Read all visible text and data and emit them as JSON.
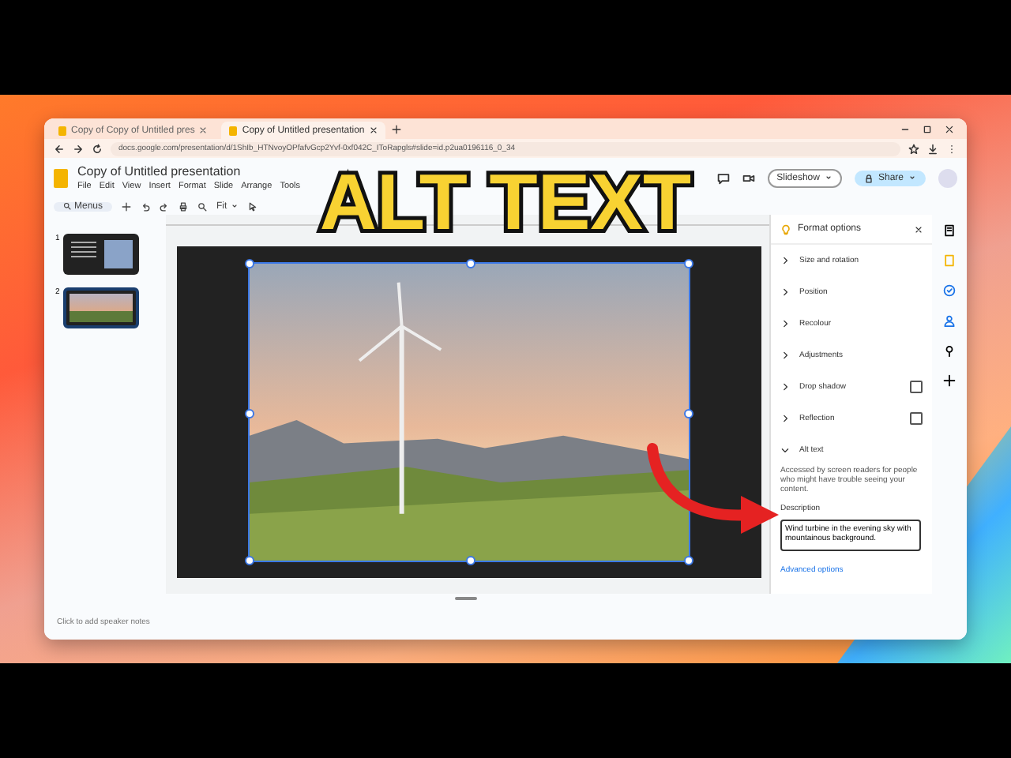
{
  "browser": {
    "tabs": [
      {
        "label": "Copy of Copy of Untitled pres",
        "selected": false
      },
      {
        "label": "Copy of Untitled presentation",
        "selected": true
      }
    ],
    "url": "docs.google.com/presentation/d/1ShIb_HTNvoyOPfafvGcp2Yvf-0xf042C_IToRapgls#slide=id.p2ua0196116_0_34"
  },
  "document": {
    "title": "Copy of Untitled presentation",
    "menus": [
      "File",
      "Edit",
      "View",
      "Insert",
      "Format",
      "Slide",
      "Arrange",
      "Tools"
    ]
  },
  "toolbar": {
    "search": "Menus",
    "zoom": "Fit"
  },
  "header_buttons": {
    "slideshow": "Slideshow",
    "share": "Share"
  },
  "slides": [
    {
      "number": "1",
      "selected": false
    },
    {
      "number": "2",
      "selected": true
    }
  ],
  "speaker_notes": {
    "placeholder": "Click to add speaker notes"
  },
  "format_panel": {
    "title": "Format options",
    "sections": [
      {
        "label": "Size and rotation",
        "kind": "plain",
        "expanded": false
      },
      {
        "label": "Position",
        "kind": "plain",
        "expanded": false
      },
      {
        "label": "Recolour",
        "kind": "plain",
        "expanded": false
      },
      {
        "label": "Adjustments",
        "kind": "plain",
        "expanded": false
      },
      {
        "label": "Drop shadow",
        "kind": "toggle",
        "expanded": false,
        "checked": false
      },
      {
        "label": "Reflection",
        "kind": "toggle",
        "expanded": false,
        "checked": false
      },
      {
        "label": "Alt text",
        "kind": "plain",
        "expanded": true
      }
    ],
    "alt_text": {
      "hint": "Accessed by screen readers for people who might have trouble seeing your content.",
      "description_label": "Description",
      "description": "Wind turbine in the evening sky with mountainous background.",
      "link": "Advanced options"
    }
  },
  "overlay_title": "ALT TEXT"
}
